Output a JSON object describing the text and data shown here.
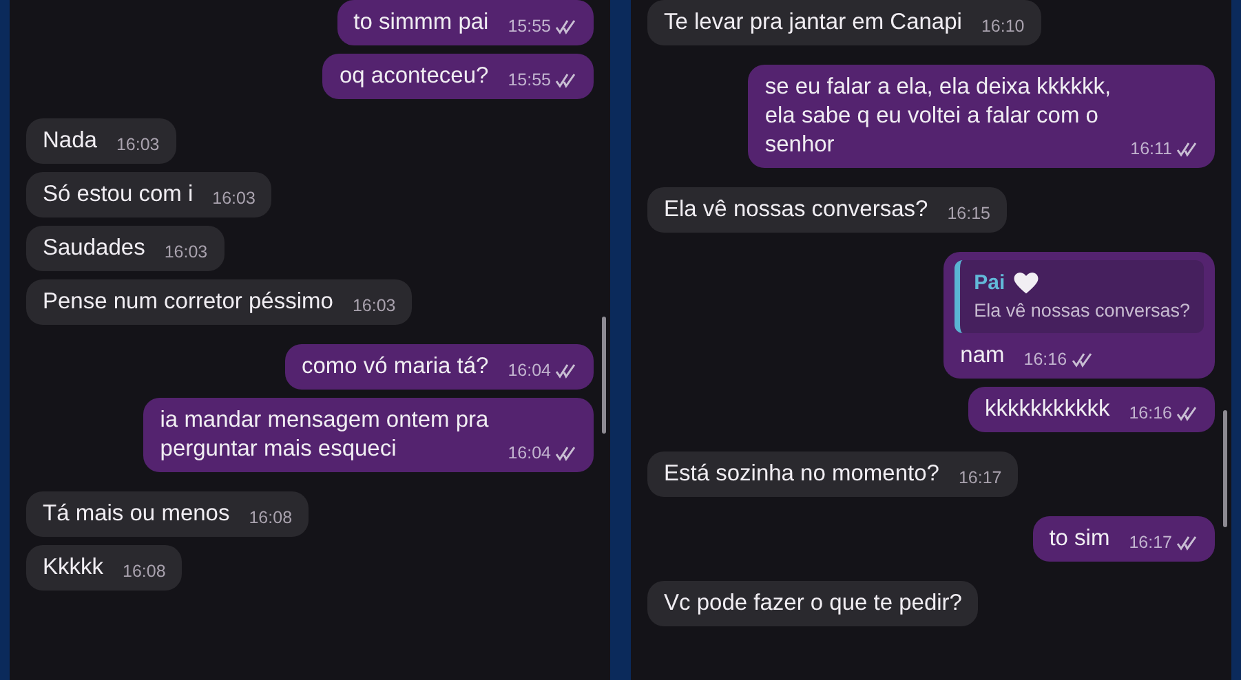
{
  "panels": [
    {
      "messages": [
        {
          "kind": "out",
          "text": "to simmm pai",
          "time": "15:55"
        },
        {
          "kind": "out",
          "text": "oq aconteceu?",
          "time": "15:55"
        },
        {
          "kind": "in",
          "text": "Nada",
          "time": "16:03"
        },
        {
          "kind": "in",
          "text": "Só estou com i",
          "time": "16:03"
        },
        {
          "kind": "in",
          "text": "Saudades",
          "time": "16:03"
        },
        {
          "kind": "in",
          "text": "Pense num corretor péssimo",
          "time": "16:03"
        },
        {
          "kind": "out",
          "text": "como vó maria tá?",
          "time": "16:04"
        },
        {
          "kind": "out",
          "text": "ia mandar mensagem ontem pra\nperguntar mais esqueci",
          "time": "16:04"
        },
        {
          "kind": "in",
          "text": "Tá mais ou menos",
          "time": "16:08"
        },
        {
          "kind": "in",
          "text": "Kkkkk",
          "time": "16:08"
        }
      ]
    },
    {
      "messages": [
        {
          "kind": "in",
          "text": "Te levar pra jantar em Canapi",
          "time": "16:10"
        },
        {
          "kind": "out",
          "text": "se eu falar a ela, ela deixa kkkkkk,\nela sabe q eu voltei a falar com o\nsenhor",
          "time": "16:11"
        },
        {
          "kind": "in",
          "text": "Ela vê nossas conversas?",
          "time": "16:15"
        },
        {
          "kind": "out",
          "text": "nam",
          "time": "16:16",
          "reply": {
            "author": "Pai",
            "quote": "Ela vê nossas conversas?"
          }
        },
        {
          "kind": "out",
          "text": "kkkkkkkkkkk",
          "time": "16:16"
        },
        {
          "kind": "in",
          "text": "Está sozinha no momento?",
          "time": "16:17"
        },
        {
          "kind": "out",
          "text": "to sim",
          "time": "16:17"
        },
        {
          "kind": "in",
          "text": "Vc pode fazer o que te pedir?"
        }
      ]
    }
  ]
}
